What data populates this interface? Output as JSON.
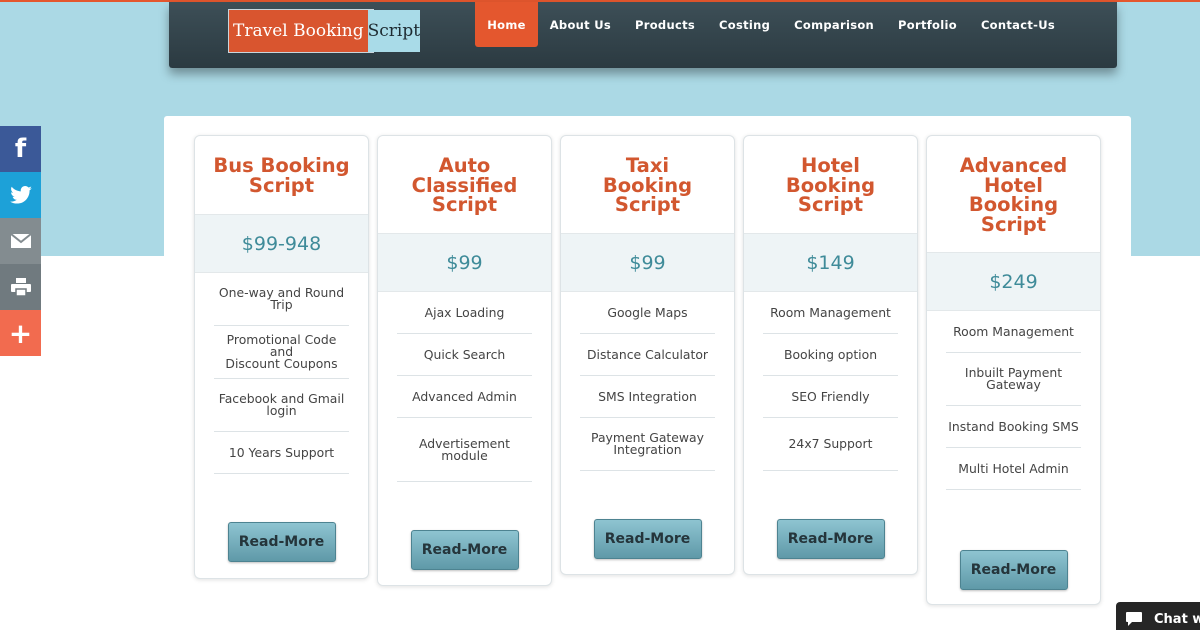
{
  "logo": {
    "part1": "Travel Booking",
    "part2": "Script"
  },
  "nav": [
    {
      "label": "Home",
      "active": true
    },
    {
      "label": "About Us"
    },
    {
      "label": "Products"
    },
    {
      "label": "Costing"
    },
    {
      "label": "Comparison"
    },
    {
      "label": "Portfolio"
    },
    {
      "label": "Contact-Us"
    }
  ],
  "share": {
    "facebook": {
      "icon": "facebook-icon",
      "glyph": "f",
      "color": "#3b5998"
    },
    "twitter": {
      "icon": "twitter-icon",
      "color": "#1da1d8"
    },
    "email": {
      "icon": "mail-icon",
      "color": "#838c90"
    },
    "print": {
      "icon": "printer-icon",
      "color": "#707a7f"
    },
    "more": {
      "icon": "plus-icon",
      "glyph": "+",
      "color": "#f26b4f"
    }
  },
  "cards": [
    {
      "title_lines": [
        "Bus Booking",
        "Script"
      ],
      "price": "$99-948",
      "features": [
        [
          "One-way and Round",
          "Trip"
        ],
        [
          "Promotional Code and",
          "Discount Coupons"
        ],
        [
          "Facebook and Gmail",
          "login"
        ],
        [
          "10 Years Support"
        ]
      ],
      "button": "Read-More"
    },
    {
      "title_lines": [
        "Auto",
        "Classified",
        "Script"
      ],
      "price": "$99",
      "features": [
        [
          "Ajax Loading"
        ],
        [
          "Quick Search"
        ],
        [
          "Advanced Admin"
        ],
        [
          "Advertisement",
          "module"
        ]
      ],
      "button": "Read-More"
    },
    {
      "title_lines": [
        "Taxi",
        "Booking",
        "Script"
      ],
      "price": "$99",
      "features": [
        [
          "Google Maps"
        ],
        [
          "Distance Calculator"
        ],
        [
          "SMS Integration"
        ],
        [
          "Payment Gateway",
          "Integration"
        ]
      ],
      "button": "Read-More"
    },
    {
      "title_lines": [
        "Hotel",
        "Booking",
        "Script"
      ],
      "price": "$149",
      "features": [
        [
          "Room Management"
        ],
        [
          "Booking option"
        ],
        [
          "SEO Friendly"
        ],
        [
          "24x7 Support"
        ]
      ],
      "button": "Read-More"
    },
    {
      "title_lines": [
        "Advanced",
        "Hotel",
        "Booking",
        "Script"
      ],
      "price": "$249",
      "features": [
        [
          "Room Management"
        ],
        [
          "Inbuilt Payment",
          "Gateway"
        ],
        [
          "Instand Booking SMS"
        ],
        [
          "Multi Hotel Admin"
        ]
      ],
      "button": "Read-More"
    }
  ],
  "chat": {
    "label": "Chat w",
    "icon": "chat-bubble-icon"
  }
}
